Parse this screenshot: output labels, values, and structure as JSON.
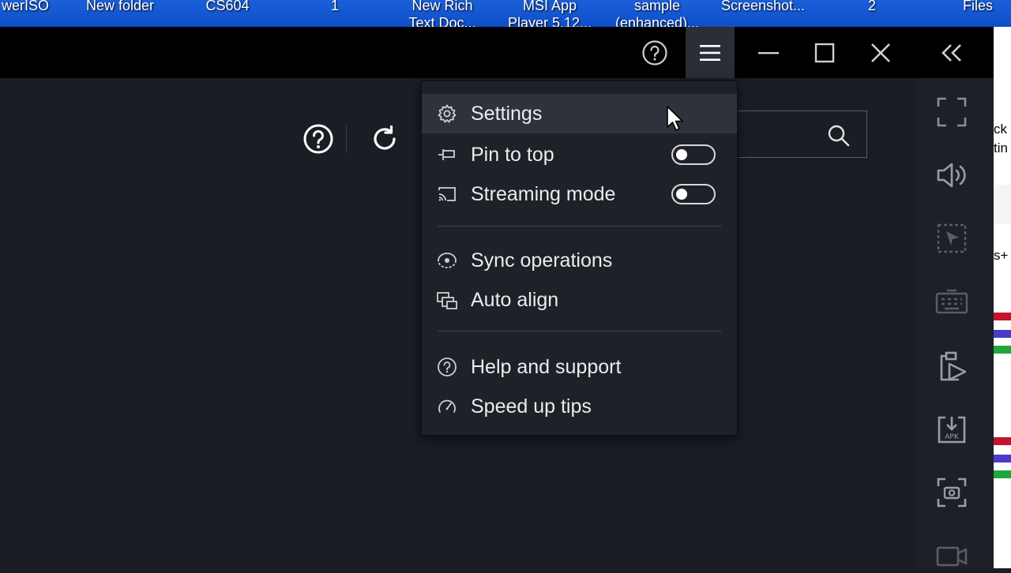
{
  "desktop": {
    "labels": [
      "werISO",
      "New folder",
      "CS604",
      "1",
      "New Rich\nText Doc...",
      "MSI App\nPlayer 5.12...",
      "sample\n(enhanced)...",
      "Screenshot...",
      "2",
      "Files"
    ],
    "right_edge_text": [
      "ck",
      "tin",
      "s+"
    ]
  },
  "titlebar": {
    "buttons": [
      "help-icon",
      "hamburger-menu-icon",
      "minimize-icon",
      "maximize-icon",
      "close-icon",
      "collapse-sidebar-icon"
    ]
  },
  "toolbar": {
    "icons": [
      "help-circle-icon",
      "refresh-icon",
      "search-icon"
    ]
  },
  "menu": {
    "items": [
      {
        "label": "Settings",
        "icon": "gear-icon",
        "hover": true
      },
      {
        "label": "Pin to top",
        "icon": "pin-icon",
        "toggle": false
      },
      {
        "label": "Streaming mode",
        "icon": "cast-icon",
        "toggle": false
      },
      {
        "label": "Sync operations",
        "icon": "eye-sync-icon"
      },
      {
        "label": "Auto align",
        "icon": "windows-align-icon"
      },
      {
        "label": "Help and support",
        "icon": "question-circle-icon"
      },
      {
        "label": "Speed up tips",
        "icon": "gauge-icon"
      }
    ]
  },
  "sidebar": {
    "icons": [
      "fullscreen-icon",
      "volume-icon",
      "select-area-icon",
      "keyboard-icon",
      "media-manager-icon",
      "install-apk-icon",
      "screenshot-icon",
      "record-icon"
    ]
  },
  "colors": {
    "background": "#1a1d24",
    "titlebar": "#000000",
    "menu": "#1e2128",
    "menu_hover": "#2e323b",
    "desktop_blue": "#1a5fd9"
  }
}
